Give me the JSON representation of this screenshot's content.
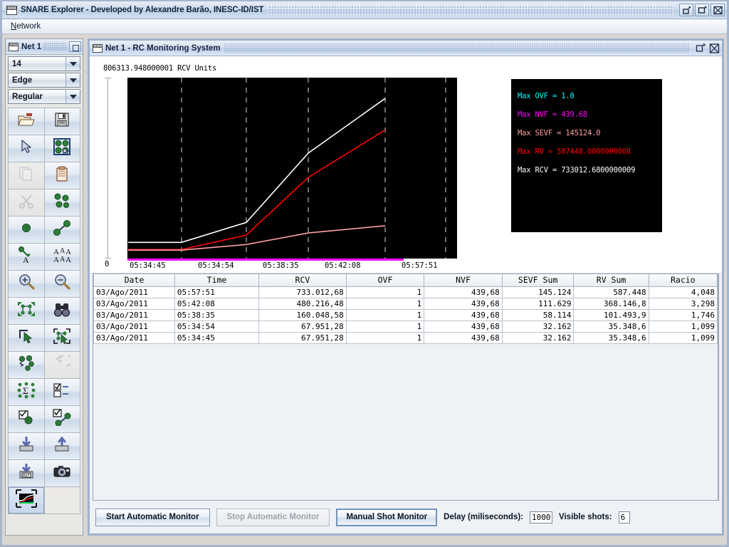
{
  "window": {
    "title": "SNARE Explorer - Developed by Alexandre Barão, INESC-ID/IST",
    "icon": "window-icon",
    "buttons": {
      "minimize": "minimize-icon",
      "maximize": "maximize-icon",
      "close": "close-icon"
    }
  },
  "menubar": {
    "items": [
      {
        "label": "Network",
        "mnemonic": "N",
        "rest": "etwork"
      }
    ]
  },
  "palette": {
    "title": "Net 1",
    "restore_button": "restore-icon",
    "combos": [
      {
        "name": "zoom-level",
        "value": "14"
      },
      {
        "name": "element-type",
        "value": "Edge"
      },
      {
        "name": "style",
        "value": "Regular"
      }
    ],
    "tools": [
      {
        "name": "open-folder-tool",
        "icon": "folder-open-icon",
        "state": "normal"
      },
      {
        "name": "save-tool",
        "icon": "floppy-save-icon",
        "state": "normal"
      },
      {
        "name": "select-pointer-tool",
        "icon": "arrow-pointer-icon",
        "state": "normal"
      },
      {
        "name": "select-all-nodes-tool",
        "icon": "select-all-nodes-icon",
        "state": "normal"
      },
      {
        "name": "copy-tool",
        "icon": "copy-pages-icon",
        "state": "disabled"
      },
      {
        "name": "paste-tool",
        "icon": "clipboard-paste-icon",
        "state": "normal"
      },
      {
        "name": "cut-tool",
        "icon": "scissors-cut-icon",
        "state": "disabled"
      },
      {
        "name": "duplicate-nodes-tool",
        "icon": "multi-nodes-icon",
        "state": "normal"
      },
      {
        "name": "add-node-tool",
        "icon": "single-node-icon",
        "state": "normal"
      },
      {
        "name": "add-edge-tool",
        "icon": "edge-link-icon",
        "state": "normal"
      },
      {
        "name": "node-label-tool",
        "icon": "node-label-icon",
        "state": "normal"
      },
      {
        "name": "all-labels-tool",
        "icon": "all-labels-icon",
        "state": "normal"
      },
      {
        "name": "zoom-in-tool",
        "icon": "zoom-in-icon",
        "state": "normal"
      },
      {
        "name": "zoom-out-tool",
        "icon": "zoom-out-icon",
        "state": "normal"
      },
      {
        "name": "layout-expand-tool",
        "icon": "layout-expand-icon",
        "state": "normal"
      },
      {
        "name": "find-tool",
        "icon": "binoculars-icon",
        "state": "normal"
      },
      {
        "name": "select-region-tool",
        "icon": "select-corner-icon",
        "state": "normal"
      },
      {
        "name": "select-subgraph-tool",
        "icon": "select-subgraph-icon",
        "state": "normal"
      },
      {
        "name": "scatter-nodes-tool",
        "icon": "scatter-nodes-icon",
        "state": "normal"
      },
      {
        "name": "undo-tool",
        "icon": "undo-arrow-icon",
        "state": "disabled"
      },
      {
        "name": "aggregate-tool",
        "icon": "sigma-nodes-icon",
        "state": "normal"
      },
      {
        "name": "checklist-tool",
        "icon": "checklist-icon",
        "state": "normal"
      },
      {
        "name": "edit-node-tool",
        "icon": "edit-node-icon",
        "state": "normal"
      },
      {
        "name": "edit-edge-tool",
        "icon": "edit-edge-icon",
        "state": "normal"
      },
      {
        "name": "import-tool",
        "icon": "import-down-icon",
        "state": "normal"
      },
      {
        "name": "export-tool",
        "icon": "export-up-icon",
        "state": "normal"
      },
      {
        "name": "import-rdf-tool",
        "icon": "import-rdf-icon",
        "state": "normal"
      },
      {
        "name": "snapshot-tool",
        "icon": "camera-icon",
        "state": "normal"
      },
      {
        "name": "monitor-chart-tool",
        "icon": "monitor-chart-icon",
        "state": "selected"
      },
      {
        "name": "empty-slot",
        "icon": "",
        "state": "empty"
      }
    ]
  },
  "inner_frame": {
    "title": "Net 1 - RC Monitoring System",
    "maximize_button": "maximize-icon",
    "close_button": "close-icon"
  },
  "chart_data": {
    "type": "line",
    "title": "",
    "ylabel": "806313.948000001 RCV Units",
    "xlabel": "",
    "y_zero_label": "0",
    "grid": true,
    "background": "#000000",
    "ylim": [
      0,
      806313.948000001
    ],
    "categories": [
      "05:34:45",
      "05:34:54",
      "05:38:35",
      "05:42:08",
      "05:57:51"
    ],
    "x_ticks": [
      "05:34:45",
      "05:34:54",
      "05:38:35",
      "05:42:08",
      "05:57:51"
    ],
    "series": [
      {
        "name": "RCV",
        "color": "#ffffff",
        "values": [
          67951.28,
          67951.28,
          160048.58,
          480216.48,
          733012.68
        ]
      },
      {
        "name": "RV",
        "color": "#ff0000",
        "values": [
          35348.6,
          35348.6,
          101493.9,
          368146.8,
          587448.0
        ]
      },
      {
        "name": "SEVF",
        "color": "#ffa0a0",
        "values": [
          32162,
          32162,
          58114,
          111629,
          145124
        ]
      },
      {
        "name": "NVF",
        "color": "#ff00ff",
        "values": [
          439.68,
          439.68,
          439.68,
          439.68,
          439.68
        ]
      },
      {
        "name": "OVF",
        "color": "#00ffff",
        "values": [
          1.0,
          1.0,
          1.0,
          1.0,
          1.0
        ]
      }
    ],
    "legend_position": "right",
    "legend": [
      {
        "label": "Max OVF = 1.0",
        "color": "#00ffff"
      },
      {
        "label": "Max NVF = 439.68",
        "color": "#ff00ff"
      },
      {
        "label": "Max SEVF = 145124.0",
        "color": "#ffa0a0"
      },
      {
        "label": "Max RV = 587448.0000000008",
        "color": "#ff0000"
      },
      {
        "label": "Max RCV = 733012.6800000009",
        "color": "#ffffff"
      }
    ]
  },
  "table": {
    "columns": [
      "Date",
      "Time",
      "RCV",
      "OVF",
      "NVF",
      "SEVF Sum",
      "RV Sum",
      "Racio"
    ],
    "rows": [
      [
        "03/Ago/2011",
        "05:57:51",
        "733.012,68",
        "1",
        "439,68",
        "145.124",
        "587.448",
        "4,048"
      ],
      [
        "03/Ago/2011",
        "05:42:08",
        "480.216,48",
        "1",
        "439,68",
        "111.629",
        "368.146,8",
        "3,298"
      ],
      [
        "03/Ago/2011",
        "05:38:35",
        "160.048,58",
        "1",
        "439,68",
        "58.114",
        "101.493,9",
        "1,746"
      ],
      [
        "03/Ago/2011",
        "05:34:54",
        "67.951,28",
        "1",
        "439,68",
        "32.162",
        "35.348,6",
        "1,099"
      ],
      [
        "03/Ago/2011",
        "05:34:45",
        "67.951,28",
        "1",
        "439,68",
        "32.162",
        "35.348,6",
        "1,099"
      ]
    ]
  },
  "controls": {
    "start_button": "Start Automatic Monitor",
    "stop_button": "Stop Automatic Monitor",
    "manual_button": "Manual Shot Monitor",
    "delay_label": "Delay (miliseconds):",
    "delay_value": "1000",
    "shots_label": "Visible shots:",
    "shots_value": "6"
  }
}
